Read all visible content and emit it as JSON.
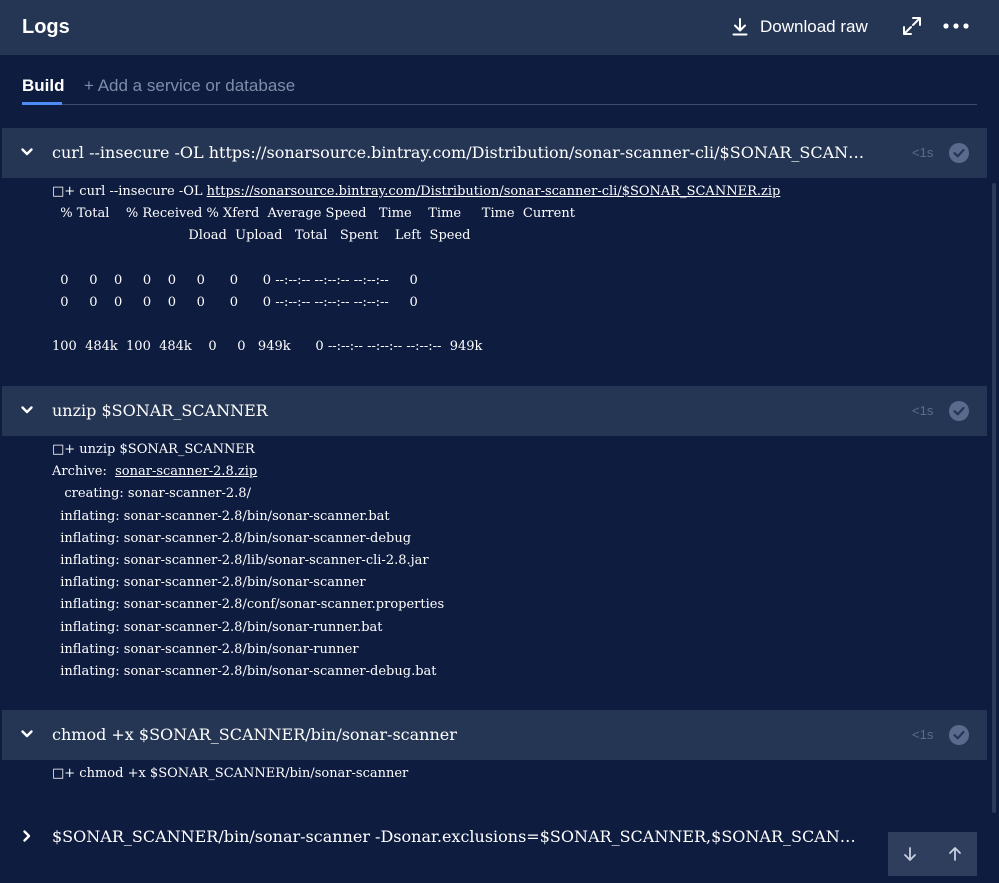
{
  "header": {
    "title": "Logs",
    "download_label": "Download raw"
  },
  "tabs": {
    "build": "Build",
    "add": "+ Add a service or database"
  },
  "colors": {
    "background": "#0e1c40",
    "header": "#253655",
    "step_bar": "#253655",
    "accent": "#4d8cf5",
    "muted": "#7f8ca8"
  },
  "steps": [
    {
      "command": "curl --insecure -OL https://sonarsource.bintray.com/Distribution/sonar-scanner-cli/$SONAR_SCANNER.zip",
      "time": "<1s",
      "log": {
        "prefix": "□+ curl --insecure -OL ",
        "url": "https://sonarsource.bintray.com/Distribution/sonar-scanner-cli/$SONAR_SCANNER.zip",
        "lines": [
          "  % Total    % Received % Xferd  Average Speed   Time    Time     Time  Current",
          "                                 Dload  Upload   Total   Spent    Left  Speed",
          "",
          "  0     0    0     0    0     0      0      0 --:--:-- --:--:-- --:--:--     0",
          "  0     0    0     0    0     0      0      0 --:--:-- --:--:-- --:--:--     0",
          "",
          "100  484k  100  484k    0     0   949k      0 --:--:-- --:--:-- --:--:--  949k"
        ]
      }
    },
    {
      "command": "unzip $SONAR_SCANNER",
      "time": "<1s",
      "log": {
        "first": "□+ unzip $SONAR_SCANNER",
        "archive_prefix": "Archive:  ",
        "archive_file": "sonar-scanner-2.8.zip",
        "lines": [
          "   creating: sonar-scanner-2.8/",
          "  inflating: sonar-scanner-2.8/bin/sonar-scanner.bat",
          "  inflating: sonar-scanner-2.8/bin/sonar-scanner-debug",
          "  inflating: sonar-scanner-2.8/lib/sonar-scanner-cli-2.8.jar",
          "  inflating: sonar-scanner-2.8/bin/sonar-scanner",
          "  inflating: sonar-scanner-2.8/conf/sonar-scanner.properties",
          "  inflating: sonar-scanner-2.8/bin/sonar-runner.bat",
          "  inflating: sonar-scanner-2.8/bin/sonar-runner",
          "  inflating: sonar-scanner-2.8/bin/sonar-scanner-debug.bat"
        ]
      }
    },
    {
      "command": "chmod +x $SONAR_SCANNER/bin/sonar-scanner",
      "time": "<1s",
      "log": {
        "first": "□+ chmod +x $SONAR_SCANNER/bin/sonar-scanner"
      }
    },
    {
      "command": "$SONAR_SCANNER/bin/sonar-scanner -Dsonar.exclusions=$SONAR_SCANNER,$SONAR_SCANNER.zip"
    }
  ]
}
